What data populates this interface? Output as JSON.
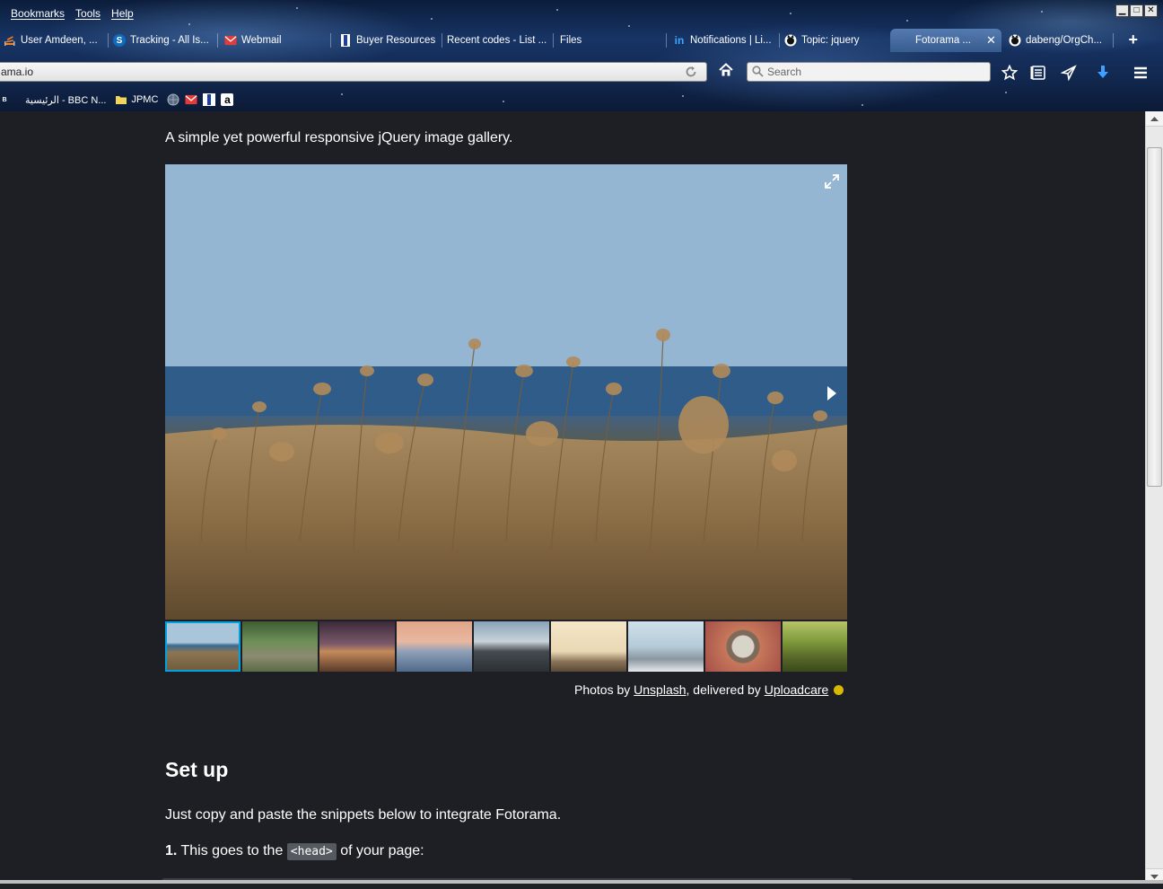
{
  "menubar": {
    "items": [
      {
        "label": "Bookmarks"
      },
      {
        "label": "Tools"
      },
      {
        "label": "Help"
      }
    ]
  },
  "window_controls": {
    "minimize": "▁",
    "maximize": "□",
    "close": "✕"
  },
  "tabs": [
    {
      "label": "User Amdeen, ...",
      "icon": "stack-overflow-icon"
    },
    {
      "label": "Tracking - All Is...",
      "icon": "sharepoint-icon"
    },
    {
      "label": "Webmail",
      "icon": "mail-icon"
    },
    {
      "label": "Buyer Resources",
      "icon": "blue-bar-icon"
    },
    {
      "label": "Recent codes - List ...",
      "icon": ""
    },
    {
      "label": "Files",
      "icon": ""
    },
    {
      "label": "Notifications | Li...",
      "icon": "linkedin-icon"
    },
    {
      "label": "Topic: jquery",
      "icon": "github-icon"
    },
    {
      "label": "Fotorama ...",
      "icon": "",
      "active": true
    },
    {
      "label": "dabeng/OrgCh...",
      "icon": "github-icon"
    }
  ],
  "new_tab_label": "+",
  "url": "ama.io",
  "search": {
    "placeholder": "Search"
  },
  "bookmarks": [
    {
      "label": "الرئيسية - BBC N...",
      "icon": "bbc-icon"
    },
    {
      "label": "JPMC",
      "icon": "folder-icon"
    },
    {
      "label": "",
      "icon": "globe-icon"
    },
    {
      "label": "",
      "icon": "mail-icon"
    },
    {
      "label": "",
      "icon": "blue-bar-icon"
    },
    {
      "label": "",
      "icon": "amazon-icon"
    }
  ],
  "page": {
    "tagline": "A simple yet powerful responsive jQuery image gallery.",
    "credits": {
      "prefix": "Photos by ",
      "unsplash": "Unsplash",
      "middle": ", delivered by ",
      "uploadcare": "Uploadcare"
    },
    "setup_title": "Set up",
    "setup_desc": "Just copy and paste the snippets below to integrate Fotorama.",
    "step1": {
      "number": "1.",
      "before": " This goes to the ",
      "code": "<head>",
      "after": " of your page:"
    }
  },
  "gallery": {
    "thumbnails": [
      {
        "name": "field",
        "active": true
      },
      {
        "name": "forest-path"
      },
      {
        "name": "city-lights"
      },
      {
        "name": "sunset-sea"
      },
      {
        "name": "mountain"
      },
      {
        "name": "beach-post"
      },
      {
        "name": "pelican-pier"
      },
      {
        "name": "coffee-cup"
      },
      {
        "name": "wooden-bench"
      }
    ]
  },
  "colors": {
    "page_bg": "#1d1f24",
    "thumb_active": "#00a3e0",
    "uploadcare_dot": "#d9b800"
  }
}
